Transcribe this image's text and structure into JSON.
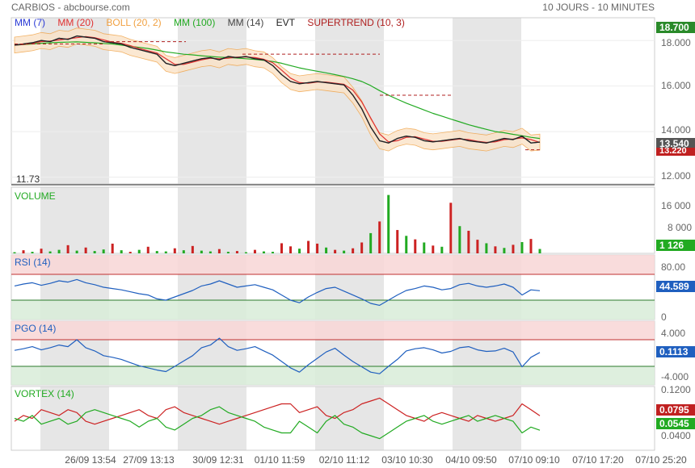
{
  "header": {
    "title": "CARBIOS - abcbourse.com",
    "period": "10 JOURS - 10 MINUTES"
  },
  "legend": [
    {
      "label": "MM (7)",
      "color": "#2b3bd6"
    },
    {
      "label": "MM (20)",
      "color": "#e03030"
    },
    {
      "label": "BOLL (20, 2)",
      "color": "#f0a040"
    },
    {
      "label": "MM (100)",
      "color": "#22aa22"
    },
    {
      "label": "MM (14)",
      "color": "#444444"
    },
    {
      "label": "EVT",
      "color": "#222222"
    },
    {
      "label": "SUPERTREND (10, 3)",
      "color": "#b02020"
    }
  ],
  "colors": {
    "up": "#22aa22",
    "down": "#cc2222",
    "rsi": "#1f5fbf",
    "grid_shade": "#e6e6e6",
    "overbought": "#f8d6d6",
    "oversold": "#d8ecd8"
  },
  "x_ticks": [
    "26/09 13:54",
    "27/09 13:13",
    "30/09 12:31",
    "01/10 11:59",
    "02/10 11:12",
    "03/10 10:30",
    "04/10 09:50",
    "07/10 09:10",
    "07/10 17:20",
    "07/10 25:20"
  ],
  "chart_data": [
    {
      "type": "line",
      "title": "",
      "ylabel": "",
      "ylim": [
        11.7,
        19.0
      ],
      "y_ticks": [
        "18.000",
        "16.000",
        "14.000",
        "12.000"
      ],
      "min_label": "11.73",
      "max_badge": "18.700",
      "last_badge": "13.540",
      "supertrend_badge": "13.220",
      "series": [
        {
          "name": "Cours",
          "values": [
            17.8,
            17.85,
            17.9,
            18.0,
            17.95,
            18.1,
            18.05,
            18.2,
            18.15,
            18.1,
            17.95,
            17.9,
            17.85,
            17.7,
            17.6,
            17.5,
            17.4,
            17.0,
            16.9,
            17.0,
            17.1,
            17.2,
            17.25,
            17.15,
            17.3,
            17.25,
            17.3,
            17.2,
            17.15,
            16.9,
            16.5,
            16.2,
            16.1,
            16.15,
            16.2,
            16.15,
            16.1,
            16.05,
            15.6,
            15.0,
            14.2,
            13.6,
            13.5,
            13.7,
            13.8,
            13.75,
            13.6,
            13.55,
            13.6,
            13.65,
            13.7,
            13.6,
            13.55,
            13.5,
            13.6,
            13.7,
            13.65,
            13.8,
            13.5,
            13.54
          ]
        },
        {
          "name": "MM (100)",
          "values": [
            17.8,
            17.82,
            17.85,
            17.88,
            17.9,
            17.92,
            17.93,
            17.94,
            17.92,
            17.9,
            17.87,
            17.85,
            17.8,
            17.75,
            17.7,
            17.65,
            17.58,
            17.5,
            17.45,
            17.4,
            17.37,
            17.33,
            17.3,
            17.27,
            17.25,
            17.23,
            17.2,
            17.17,
            17.13,
            17.08,
            17.0,
            16.9,
            16.8,
            16.72,
            16.65,
            16.58,
            16.5,
            16.42,
            16.32,
            16.2,
            16.02,
            15.8,
            15.6,
            15.42,
            15.25,
            15.1,
            14.95,
            14.8,
            14.68,
            14.55,
            14.43,
            14.3,
            14.2,
            14.1,
            14.0,
            13.95,
            13.88,
            13.82,
            13.75,
            13.7
          ]
        }
      ]
    },
    {
      "type": "bar",
      "title": "VOLUME",
      "ylim": [
        0,
        17000
      ],
      "y_ticks": [
        "16 000",
        "8 000"
      ],
      "last_badge": "1 126",
      "values": [
        300,
        800,
        400,
        1200,
        500,
        900,
        2100,
        700,
        1500,
        600,
        1000,
        2500,
        800,
        400,
        900,
        1700,
        600,
        500,
        1300,
        800,
        1900,
        700,
        500,
        1100,
        400,
        600,
        300,
        900,
        500,
        400,
        2600,
        1800,
        1200,
        3200,
        2500,
        1500,
        900,
        700,
        1300,
        2800,
        5200,
        8200,
        15000,
        6000,
        4500,
        3600,
        2800,
        2000,
        1700,
        13000,
        7000,
        5800,
        3500,
        2600,
        1800,
        1400,
        2200,
        2900,
        3700,
        1126
      ],
      "colors_up": [
        1,
        0,
        1,
        0,
        1,
        1,
        0,
        1,
        0,
        1,
        1,
        0,
        1,
        0,
        1,
        0,
        1,
        1,
        0,
        1,
        0,
        1,
        1,
        0,
        1,
        0,
        1,
        0,
        1,
        1,
        0,
        0,
        1,
        0,
        0,
        1,
        0,
        1,
        0,
        0,
        1,
        0,
        1,
        0,
        1,
        0,
        1,
        0,
        1,
        0,
        1,
        0,
        0,
        1,
        0,
        1,
        0,
        1,
        0,
        1
      ]
    },
    {
      "type": "line",
      "title": "RSI (14)",
      "ylim": [
        0,
        100
      ],
      "y_ticks": [
        "80.00",
        "0"
      ],
      "bands": [
        30,
        70
      ],
      "last_badge": "44.589",
      "values": [
        52,
        55,
        57,
        53,
        56,
        60,
        58,
        62,
        57,
        54,
        50,
        48,
        46,
        43,
        40,
        38,
        32,
        30,
        35,
        40,
        45,
        52,
        55,
        60,
        55,
        50,
        52,
        54,
        50,
        46,
        38,
        30,
        26,
        35,
        42,
        48,
        50,
        44,
        38,
        32,
        25,
        22,
        30,
        38,
        45,
        48,
        52,
        50,
        46,
        48,
        54,
        56,
        52,
        50,
        52,
        55,
        50,
        38,
        46,
        44.589
      ]
    },
    {
      "type": "line",
      "title": "PGO (14)",
      "ylim": [
        -6,
        6
      ],
      "y_ticks": [
        "4.000",
        "-4.000"
      ],
      "bands": [
        -2.5,
        2.5
      ],
      "last_badge": "0.1113",
      "values": [
        0.5,
        0.8,
        1.2,
        0.6,
        1.0,
        1.5,
        1.2,
        2.5,
        1.0,
        0.4,
        -0.5,
        -0.8,
        -1.2,
        -1.8,
        -2.4,
        -2.8,
        -3.2,
        -3.5,
        -2.5,
        -1.5,
        -0.5,
        1.0,
        1.5,
        2.8,
        1.2,
        0.5,
        0.8,
        1.2,
        0.4,
        -0.4,
        -1.6,
        -2.8,
        -3.6,
        -2.2,
        -1.0,
        0.2,
        0.9,
        -0.4,
        -1.6,
        -2.6,
        -3.6,
        -3.9,
        -2.5,
        -1.2,
        0.4,
        0.8,
        1.0,
        0.6,
        0.0,
        0.3,
        1.0,
        1.2,
        0.6,
        0.3,
        0.4,
        0.9,
        0.2,
        -2.6,
        -0.8,
        0.1113
      ]
    },
    {
      "type": "line",
      "title": "VORTEX (14)",
      "ylim": [
        0.02,
        0.13
      ],
      "y_ticks": [
        "0.1200",
        "0.0400"
      ],
      "series": [
        {
          "name": "VI-",
          "color": "#cc2222",
          "last_badge": "0.0795",
          "values": [
            0.07,
            0.08,
            0.075,
            0.09,
            0.085,
            0.08,
            0.09,
            0.085,
            0.07,
            0.065,
            0.07,
            0.075,
            0.08,
            0.085,
            0.09,
            0.08,
            0.075,
            0.09,
            0.095,
            0.085,
            0.08,
            0.075,
            0.07,
            0.065,
            0.07,
            0.075,
            0.08,
            0.085,
            0.09,
            0.095,
            0.1,
            0.1,
            0.085,
            0.09,
            0.095,
            0.08,
            0.075,
            0.085,
            0.09,
            0.1,
            0.105,
            0.11,
            0.1,
            0.09,
            0.08,
            0.075,
            0.07,
            0.08,
            0.085,
            0.08,
            0.075,
            0.07,
            0.08,
            0.075,
            0.07,
            0.075,
            0.08,
            0.1,
            0.09,
            0.0795
          ]
        },
        {
          "name": "VI+",
          "color": "#22aa22",
          "last_badge": "0.0545",
          "values": [
            0.075,
            0.07,
            0.08,
            0.065,
            0.07,
            0.075,
            0.065,
            0.07,
            0.085,
            0.09,
            0.085,
            0.08,
            0.075,
            0.07,
            0.06,
            0.07,
            0.075,
            0.06,
            0.055,
            0.065,
            0.075,
            0.08,
            0.09,
            0.095,
            0.085,
            0.08,
            0.075,
            0.07,
            0.06,
            0.055,
            0.05,
            0.05,
            0.07,
            0.06,
            0.05,
            0.07,
            0.08,
            0.065,
            0.06,
            0.05,
            0.045,
            0.04,
            0.05,
            0.06,
            0.07,
            0.075,
            0.08,
            0.07,
            0.065,
            0.07,
            0.075,
            0.08,
            0.07,
            0.075,
            0.08,
            0.075,
            0.07,
            0.05,
            0.06,
            0.0545
          ]
        }
      ]
    }
  ]
}
